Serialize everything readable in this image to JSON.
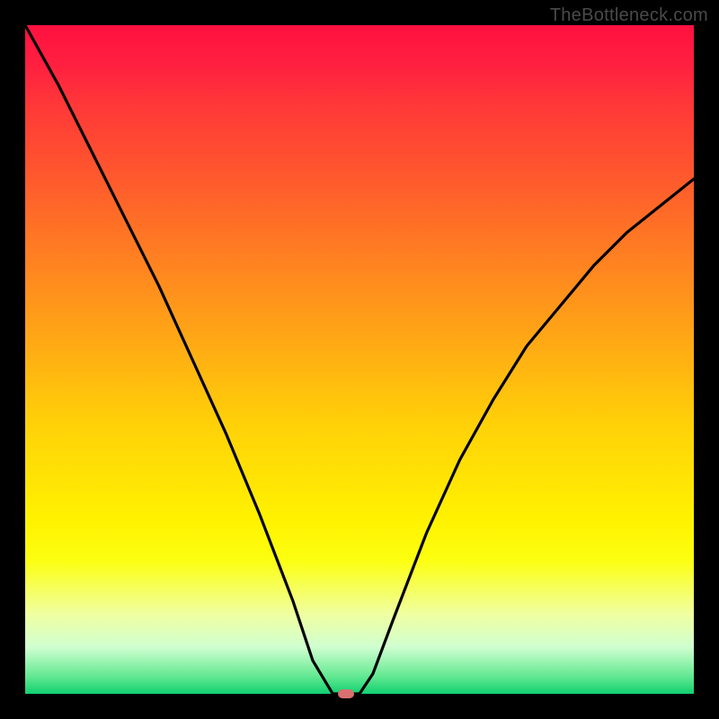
{
  "watermark": "TheBottleneck.com",
  "colors": {
    "frame": "#000000",
    "curve": "#000000",
    "marker": "#d97070",
    "gradient_top": "#ff1040",
    "gradient_bottom": "#10d070"
  },
  "chart_data": {
    "type": "line",
    "title": "",
    "xlabel": "",
    "ylabel": "",
    "xlim": [
      0,
      100
    ],
    "ylim": [
      0,
      100
    ],
    "series": [
      {
        "name": "bottleneck-curve",
        "x": [
          0,
          5,
          10,
          15,
          20,
          25,
          30,
          35,
          40,
          43,
          46,
          48,
          50,
          52,
          55,
          60,
          65,
          70,
          75,
          80,
          85,
          90,
          95,
          100
        ],
        "values": [
          100,
          91,
          81,
          71,
          61,
          50,
          39,
          27,
          14,
          5,
          0,
          0,
          0,
          3,
          11,
          24,
          35,
          44,
          52,
          58,
          64,
          69,
          73,
          77
        ]
      }
    ],
    "marker": {
      "x": 48,
      "y": 0,
      "width_pct": 2.4,
      "height_pct": 1.3
    },
    "annotations": []
  }
}
